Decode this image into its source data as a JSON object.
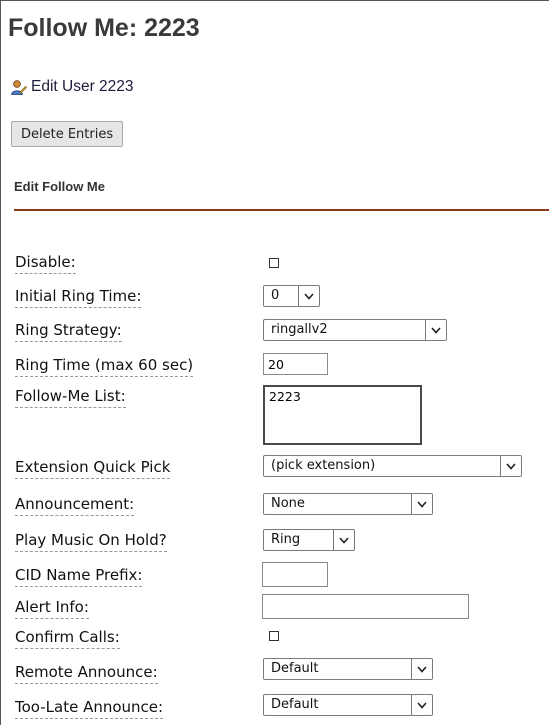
{
  "page": {
    "title": "Follow Me: 2223"
  },
  "edit_user": {
    "icon": "user-edit-icon",
    "label": "Edit User 2223"
  },
  "actions": {
    "delete_label": "Delete Entries"
  },
  "section": {
    "title": "Edit Follow Me",
    "accent_color": "#8a3a14"
  },
  "form": {
    "disable": {
      "label": "Disable:",
      "checked": false
    },
    "initial_ring_time": {
      "label": "Initial Ring Time:",
      "value": "0"
    },
    "ring_strategy": {
      "label": "Ring Strategy:",
      "value": "ringallv2"
    },
    "ring_time": {
      "label": "Ring Time (max 60 sec)",
      "value": "20"
    },
    "follow_me_list": {
      "label": "Follow-Me List:",
      "value": "2223"
    },
    "extension_quick_pick": {
      "label": "Extension Quick Pick",
      "value": "(pick extension)"
    },
    "announcement": {
      "label": "Announcement:",
      "value": "None"
    },
    "play_moh": {
      "label": "Play Music On Hold?",
      "value": "Ring"
    },
    "cid_name_prefix": {
      "label": "CID Name Prefix:",
      "value": ""
    },
    "alert_info": {
      "label": "Alert Info:",
      "value": ""
    },
    "confirm_calls": {
      "label": "Confirm Calls:",
      "checked": false
    },
    "remote_announce": {
      "label": "Remote Announce:",
      "value": "Default"
    },
    "too_late_announce": {
      "label": "Too-Late Announce:",
      "value": "Default"
    }
  }
}
